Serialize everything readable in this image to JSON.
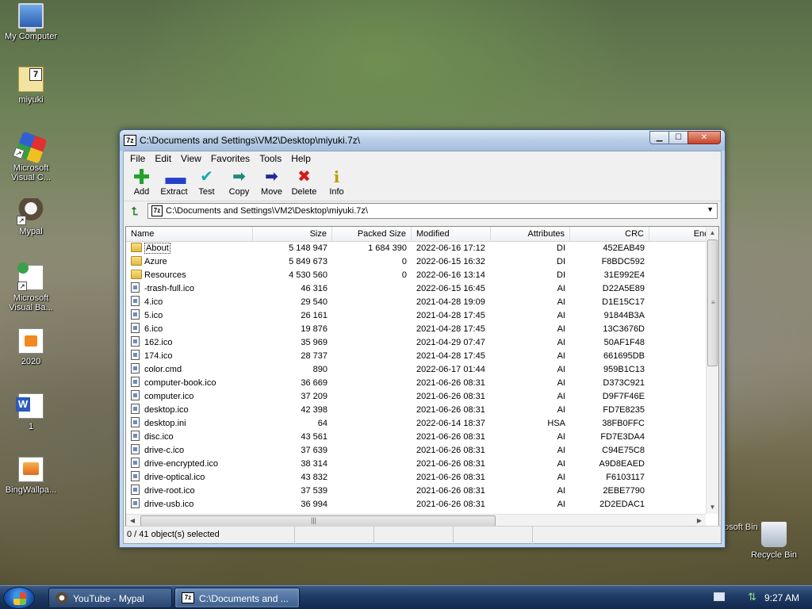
{
  "desktop": {
    "icons": [
      {
        "label": "My Computer",
        "kind": "computer"
      },
      {
        "label": "miyuki",
        "kind": "7z"
      },
      {
        "label": "Microsoft Visual C...",
        "kind": "vc"
      },
      {
        "label": "Mypal",
        "kind": "mypal"
      },
      {
        "label": "Microsoft Visual Ba...",
        "kind": "vb"
      },
      {
        "label": "2020",
        "kind": "doc"
      },
      {
        "label": "1",
        "kind": "word"
      },
      {
        "label": "BingWallpa...",
        "kind": "bing"
      }
    ],
    "recycle_bin": "Recycle Bin",
    "partial_text": "osoft Bin"
  },
  "window": {
    "title": "C:\\Documents and Settings\\VM2\\Desktop\\miyuki.7z\\",
    "app_icon": "7z",
    "menu": [
      "File",
      "Edit",
      "View",
      "Favorites",
      "Tools",
      "Help"
    ],
    "toolbar": [
      {
        "label": "Add",
        "icon": "plus-icon",
        "glyph": "✚"
      },
      {
        "label": "Extract",
        "icon": "minus-icon",
        "glyph": "▬"
      },
      {
        "label": "Test",
        "icon": "checkmark-icon",
        "glyph": "✔"
      },
      {
        "label": "Copy",
        "icon": "copy-arrow-icon",
        "glyph": "➡"
      },
      {
        "label": "Move",
        "icon": "move-arrow-icon",
        "glyph": "➡"
      },
      {
        "label": "Delete",
        "icon": "delete-x-icon",
        "glyph": "✖"
      },
      {
        "label": "Info",
        "icon": "info-icon",
        "glyph": "i"
      }
    ],
    "address": "C:\\Documents and Settings\\VM2\\Desktop\\miyuki.7z\\",
    "columns": {
      "name": "Name",
      "size": "Size",
      "packed": "Packed Size",
      "modified": "Modified",
      "attributes": "Attributes",
      "crc": "CRC",
      "encrypted": "Encrypt"
    },
    "files": [
      {
        "name": "About",
        "type": "folder",
        "size": "5 148 947",
        "packed": "1 684 390",
        "modified": "2022-06-16 17:12",
        "attr": "DI",
        "crc": "452EAB49"
      },
      {
        "name": "Azure",
        "type": "folder",
        "size": "5 849 673",
        "packed": "0",
        "modified": "2022-06-15 16:32",
        "attr": "DI",
        "crc": "F8BDC592"
      },
      {
        "name": "Resources",
        "type": "folder",
        "size": "4 530 560",
        "packed": "0",
        "modified": "2022-06-16 13:14",
        "attr": "DI",
        "crc": "31E992E4"
      },
      {
        "name": "-trash-full.ico",
        "type": "file",
        "size": "46 316",
        "packed": "",
        "modified": "2022-06-15 16:45",
        "attr": "AI",
        "crc": "D22A5E89"
      },
      {
        "name": "4.ico",
        "type": "file",
        "size": "29 540",
        "packed": "",
        "modified": "2021-04-28 19:09",
        "attr": "AI",
        "crc": "D1E15C17"
      },
      {
        "name": "5.ico",
        "type": "file",
        "size": "26 161",
        "packed": "",
        "modified": "2021-04-28 17:45",
        "attr": "AI",
        "crc": "91844B3A"
      },
      {
        "name": "6.ico",
        "type": "file",
        "size": "19 876",
        "packed": "",
        "modified": "2021-04-28 17:45",
        "attr": "AI",
        "crc": "13C3676D"
      },
      {
        "name": "162.ico",
        "type": "file",
        "size": "35 969",
        "packed": "",
        "modified": "2021-04-29 07:47",
        "attr": "AI",
        "crc": "50AF1F48"
      },
      {
        "name": "174.ico",
        "type": "file",
        "size": "28 737",
        "packed": "",
        "modified": "2021-04-28 17:45",
        "attr": "AI",
        "crc": "661695DB"
      },
      {
        "name": "color.cmd",
        "type": "file",
        "size": "890",
        "packed": "",
        "modified": "2022-06-17 01:44",
        "attr": "AI",
        "crc": "959B1C13"
      },
      {
        "name": "computer-book.ico",
        "type": "file",
        "size": "36 669",
        "packed": "",
        "modified": "2021-06-26 08:31",
        "attr": "AI",
        "crc": "D373C921"
      },
      {
        "name": "computer.ico",
        "type": "file",
        "size": "37 209",
        "packed": "",
        "modified": "2021-06-26 08:31",
        "attr": "AI",
        "crc": "D9F7F46E"
      },
      {
        "name": "desktop.ico",
        "type": "file",
        "size": "42 398",
        "packed": "",
        "modified": "2021-06-26 08:31",
        "attr": "AI",
        "crc": "FD7E8235"
      },
      {
        "name": "desktop.ini",
        "type": "file",
        "size": "64",
        "packed": "",
        "modified": "2022-06-14 18:37",
        "attr": "HSA",
        "crc": "38FB0FFC"
      },
      {
        "name": "disc.ico",
        "type": "file",
        "size": "43 561",
        "packed": "",
        "modified": "2021-06-26 08:31",
        "attr": "AI",
        "crc": "FD7E3DA4"
      },
      {
        "name": "drive-c.ico",
        "type": "file",
        "size": "37 639",
        "packed": "",
        "modified": "2021-06-26 08:31",
        "attr": "AI",
        "crc": "C94E75C8"
      },
      {
        "name": "drive-encrypted.ico",
        "type": "file",
        "size": "38 314",
        "packed": "",
        "modified": "2021-06-26 08:31",
        "attr": "AI",
        "crc": "A9D8EAED"
      },
      {
        "name": "drive-optical.ico",
        "type": "file",
        "size": "43 832",
        "packed": "",
        "modified": "2021-06-26 08:31",
        "attr": "AI",
        "crc": "F6103117"
      },
      {
        "name": "drive-root.ico",
        "type": "file",
        "size": "37 539",
        "packed": "",
        "modified": "2021-06-26 08:31",
        "attr": "AI",
        "crc": "2EBE7790"
      },
      {
        "name": "drive-usb.ico",
        "type": "file",
        "size": "36 994",
        "packed": "",
        "modified": "2021-06-26 08:31",
        "attr": "AI",
        "crc": "2D2EDAC1"
      }
    ],
    "status": "0 / 41 object(s) selected"
  },
  "taskbar": {
    "tasks": [
      {
        "label": "YouTube - Mypal",
        "icon": "mypal"
      },
      {
        "label": "C:\\Documents and ...",
        "icon": "7z"
      }
    ],
    "clock": "9:27 AM"
  },
  "colors": {
    "titlebar": "#b8cde7",
    "taskbar": "#1e3a64",
    "folder": "#e2b83e"
  }
}
